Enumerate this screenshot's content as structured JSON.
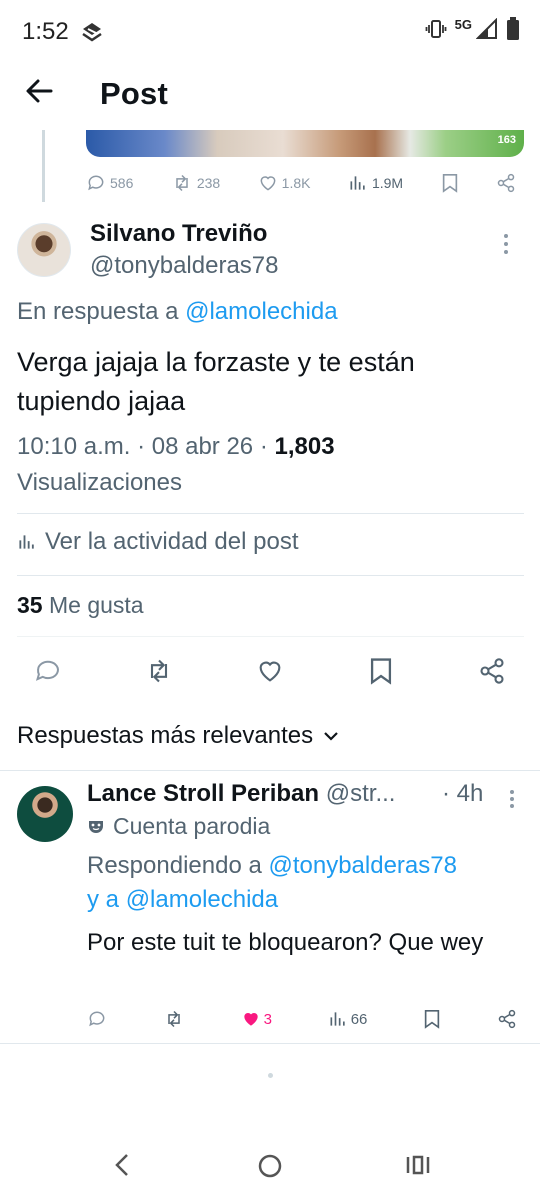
{
  "status": {
    "time": "1:52",
    "network": "5G"
  },
  "header": {
    "title": "Post"
  },
  "parent_post": {
    "media_count": "163",
    "actions": {
      "replies": "586",
      "reposts": "238",
      "likes": "1.8K",
      "views": "1.9M"
    }
  },
  "main_post": {
    "author_name": "Silvano Treviño",
    "author_handle": "@tonybalderas78",
    "reply_prefix": "En respuesta a",
    "reply_mention": "@lamolechida",
    "text": "Verga jajaja la forzaste y te están tupiendo jajaa",
    "timestamp": "10:10 a.m. · 08 abr 26 · ",
    "views_count": "1,803",
    "views_label": "Visualizaciones",
    "activity_label": "Ver la actividad del post",
    "likes_count": "35",
    "likes_label": "Me gusta"
  },
  "sort": {
    "label": "Respuestas más relevantes"
  },
  "reply": {
    "author_name": "Lance Stroll Periban",
    "author_handle": "@str...",
    "time": "· 4h",
    "parody_label": "Cuenta parodia",
    "replying_prefix": "Respondiendo a",
    "mention_1": "@tonybalderas78",
    "conjunction": "y a",
    "mention_2": "@lamolechida",
    "text": "Por este tuit te bloquearon? Que wey",
    "likes": "3",
    "views": "66"
  },
  "colors": {
    "accent": "#1d9bf0",
    "like": "#f91880",
    "text": "#0f1419",
    "secondary": "#536471"
  }
}
